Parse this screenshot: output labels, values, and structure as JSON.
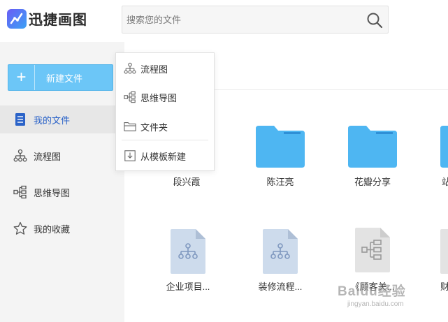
{
  "app": {
    "title": "迅捷画图"
  },
  "search": {
    "placeholder": "搜索您的文件"
  },
  "sidebar": {
    "new_button": {
      "icon": "plus",
      "label": "新建文件"
    },
    "items": [
      {
        "label": "我的文件",
        "icon": "document-icon",
        "active": true
      },
      {
        "label": "流程图",
        "icon": "flowchart-icon",
        "active": false
      },
      {
        "label": "思维导图",
        "icon": "mindmap-icon",
        "active": false
      },
      {
        "label": "我的收藏",
        "icon": "star-icon",
        "active": false
      }
    ]
  },
  "dropdown": {
    "items": [
      {
        "label": "流程图",
        "icon": "flowchart-icon"
      },
      {
        "label": "思维导图",
        "icon": "mindmap-icon"
      },
      {
        "label": "文件夹",
        "icon": "folder-icon"
      },
      {
        "label": "从模板新建",
        "icon": "template-icon"
      }
    ]
  },
  "files": {
    "row1": [
      {
        "name": "段兴霞",
        "type": "folder"
      },
      {
        "name": "陈汪亮",
        "type": "folder"
      },
      {
        "name": "花瓣分享",
        "type": "folder"
      },
      {
        "name": "站",
        "type": "folder"
      }
    ],
    "row2": [
      {
        "name": "企业项目...",
        "type": "flowchart"
      },
      {
        "name": "装修流程...",
        "type": "flowchart"
      },
      {
        "name": "《顾客关...",
        "type": "mindmap"
      },
      {
        "name": "财",
        "type": "document"
      }
    ]
  },
  "watermark": {
    "line1": "Baidu经验",
    "line2": "jingyan.baidu.com"
  },
  "colors": {
    "accent": "#6cc6f7",
    "folder": "#4eb6f2",
    "active_text": "#2b63c8"
  }
}
